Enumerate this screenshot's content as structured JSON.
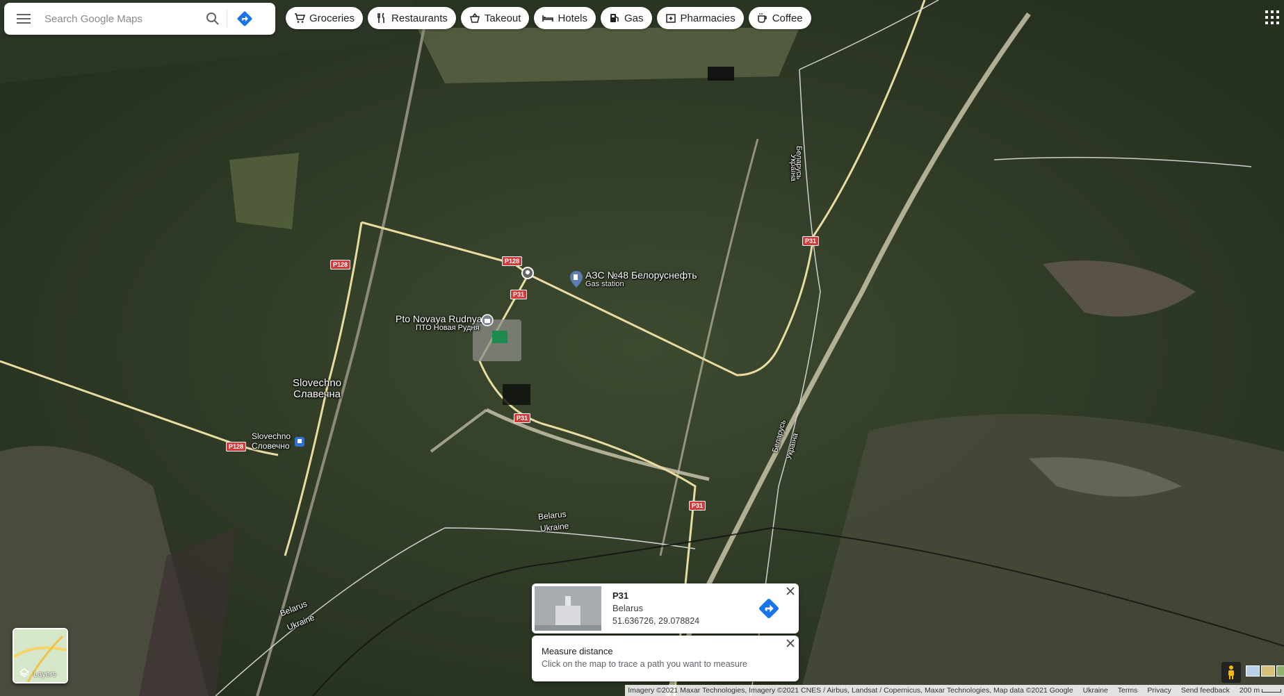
{
  "search": {
    "placeholder": "Search Google Maps"
  },
  "chips": [
    {
      "label": "Groceries",
      "icon": "cart-icon"
    },
    {
      "label": "Restaurants",
      "icon": "fork-knife-icon"
    },
    {
      "label": "Takeout",
      "icon": "takeout-icon"
    },
    {
      "label": "Hotels",
      "icon": "bed-icon"
    },
    {
      "label": "Gas",
      "icon": "gas-pump-icon"
    },
    {
      "label": "Pharmacies",
      "icon": "pharmacy-icon"
    },
    {
      "label": "Coffee",
      "icon": "coffee-icon"
    }
  ],
  "map_labels": {
    "gas_station_name": "АЗС №48 Белоруснефть",
    "gas_station_type": "Gas station",
    "pto_name": "Pto Novaya Rudnya",
    "pto_name_local": "ПТО Новая Рудня",
    "village_name": "Slovechno",
    "village_name_local": "Славечна",
    "station_name": "Slovechno",
    "station_name_local": "Словечно",
    "border_belarus_1": "Belarus",
    "border_ukraine_1": "Ukraine",
    "border_belarus_2": "Belarus",
    "border_ukraine_2": "Ukraine",
    "border_ua_vertical": "Україна",
    "border_by_vertical": "Беларусь",
    "border_by_vertical_2": "Беларусь",
    "border_ua_vertical_2": "Україна"
  },
  "road_shields": [
    "P128",
    "P128",
    "P128",
    "P31",
    "P31",
    "P31",
    "P31"
  ],
  "card": {
    "title": "P31",
    "country": "Belarus",
    "coordinates": "51.636726, 29.078824"
  },
  "measure": {
    "title": "Measure distance",
    "hint": "Click on the map to trace a path you want to measure"
  },
  "layers_label": "Layers",
  "footer": {
    "attribution": "Imagery ©2021 Maxar Technologies, Imagery ©2021 CNES / Airbus, Landsat / Copernicus, Maxar Technologies, Map data ©2021 Google",
    "region": "Ukraine",
    "terms": "Terms",
    "privacy": "Privacy",
    "feedback": "Send feedback",
    "scale": "200 m"
  },
  "colors": {
    "road": "#e9dca0",
    "shield": "#d23b3b",
    "accent": "#1a73e8"
  }
}
